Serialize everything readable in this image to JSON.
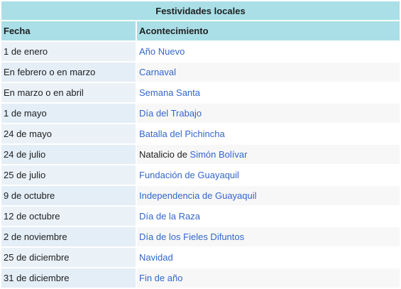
{
  "table": {
    "caption": "Festividades locales",
    "headers": [
      "Fecha",
      "Acontecimiento"
    ],
    "rows": [
      {
        "date": "1 de enero",
        "prefix": "",
        "event": "Año Nuevo"
      },
      {
        "date": "En febrero o en marzo",
        "prefix": "",
        "event": "Carnaval"
      },
      {
        "date": "En marzo o en abril",
        "prefix": "",
        "event": "Semana Santa"
      },
      {
        "date": "1 de mayo",
        "prefix": "",
        "event": "Día del Trabajo"
      },
      {
        "date": "24 de mayo",
        "prefix": "",
        "event": "Batalla del Pichincha"
      },
      {
        "date": "24 de julio",
        "prefix": "Natalicio de ",
        "event": "Simón Bolívar"
      },
      {
        "date": "25 de julio",
        "prefix": "",
        "event": "Fundación de Guayaquil"
      },
      {
        "date": "9 de octubre",
        "prefix": "",
        "event": "Independencia de Guayaquil"
      },
      {
        "date": "12 de octubre",
        "prefix": "",
        "event": "Día de la Raza"
      },
      {
        "date": "2 de noviembre",
        "prefix": "",
        "event": "Día de los Fieles Difuntos"
      },
      {
        "date": "25 de diciembre",
        "prefix": "",
        "event": "Navidad"
      },
      {
        "date": "31 de diciembre",
        "prefix": "",
        "event": "Fin de año"
      }
    ]
  },
  "colors": {
    "header_bg": "#aadfe7",
    "link": "#3366cc",
    "date_cell_bg": "#e3eef7",
    "text": "#202122"
  }
}
